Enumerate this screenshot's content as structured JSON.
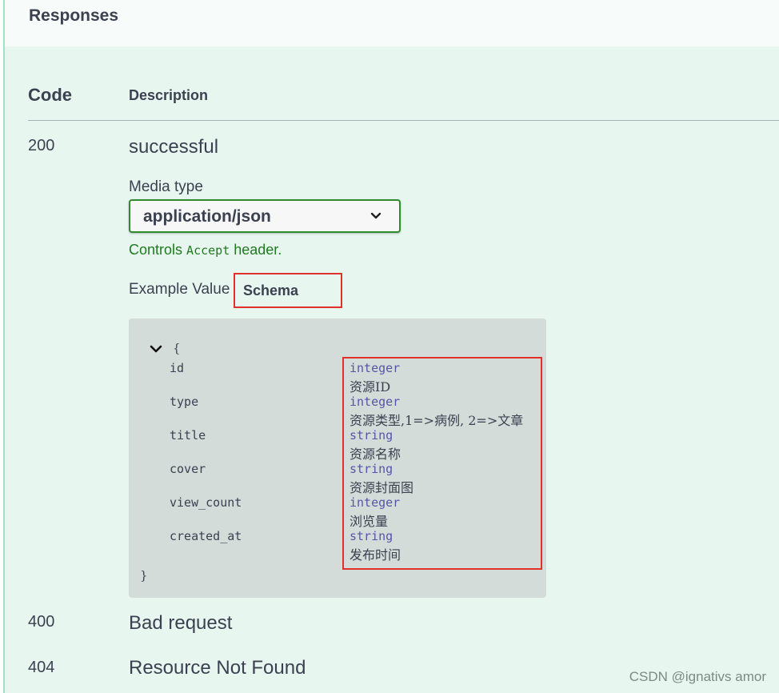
{
  "responses_title": "Responses",
  "table": {
    "code_header": "Code",
    "description_header": "Description"
  },
  "responses": [
    {
      "code": "200",
      "description": "successful"
    },
    {
      "code": "400",
      "description": "Bad request"
    },
    {
      "code": "404",
      "description": "Resource Not Found"
    }
  ],
  "media": {
    "label": "Media type",
    "selected": "application/json",
    "controls_prefix": "Controls",
    "controls_code": "Accept",
    "controls_suffix": "header."
  },
  "tabs": {
    "example_value": "Example Value",
    "schema": "Schema"
  },
  "model": {
    "open_brace": "{",
    "close_brace": "}",
    "properties": [
      {
        "name": "id",
        "type": "integer",
        "description": "资源ID"
      },
      {
        "name": "type",
        "type": "integer",
        "description": "资源类型,1=>病例, 2=>文章"
      },
      {
        "name": "title",
        "type": "string",
        "description": "资源名称"
      },
      {
        "name": "cover",
        "type": "string",
        "description": "资源封面图"
      },
      {
        "name": "view_count",
        "type": "integer",
        "description": "浏览量"
      },
      {
        "name": "created_at",
        "type": "string",
        "description": "发布时间"
      }
    ]
  },
  "watermark": "CSDN @ignativs  amor",
  "icons": {
    "select_toggle": "chevron-down-icon",
    "model_toggle": "chevron-down-icon"
  },
  "colors": {
    "background": "#e8f6f0",
    "select_border": "#2e8b2e",
    "highlight": "#e0322a",
    "model_bg": "#d3dcd8",
    "type_color": "#55a"
  }
}
